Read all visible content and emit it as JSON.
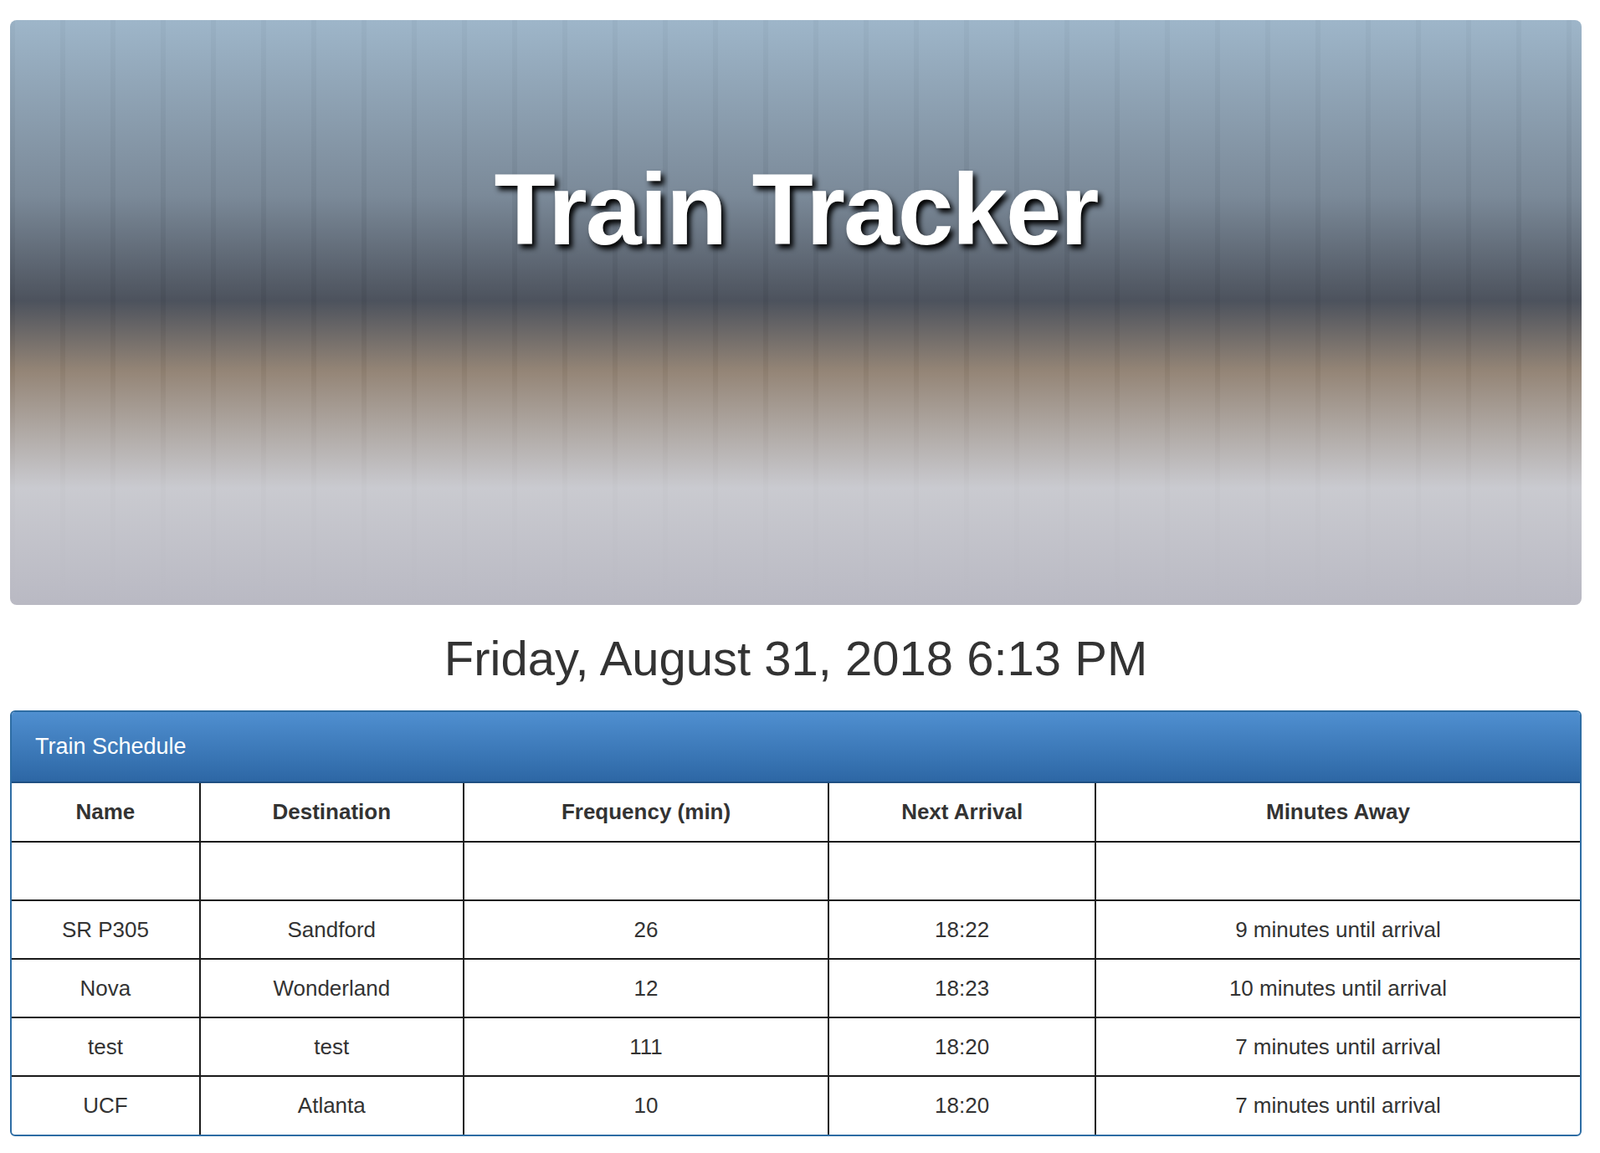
{
  "hero": {
    "title": "Train Tracker"
  },
  "clock": "Friday, August 31, 2018 6:13 PM",
  "panel": {
    "title": "Train Schedule"
  },
  "table": {
    "columns": [
      "Name",
      "Destination",
      "Frequency (min)",
      "Next Arrival",
      "Minutes Away"
    ],
    "rows": [
      [
        "",
        "",
        "",
        "",
        ""
      ],
      [
        "SR P305",
        "Sandford",
        "26",
        "18:22",
        "9 minutes until arrival"
      ],
      [
        "Nova",
        "Wonderland",
        "12",
        "18:23",
        "10 minutes until arrival"
      ],
      [
        "test",
        "test",
        "111",
        "18:20",
        "7 minutes until arrival"
      ],
      [
        "UCF",
        "Atlanta",
        "10",
        "18:20",
        "7 minutes until arrival"
      ]
    ]
  }
}
